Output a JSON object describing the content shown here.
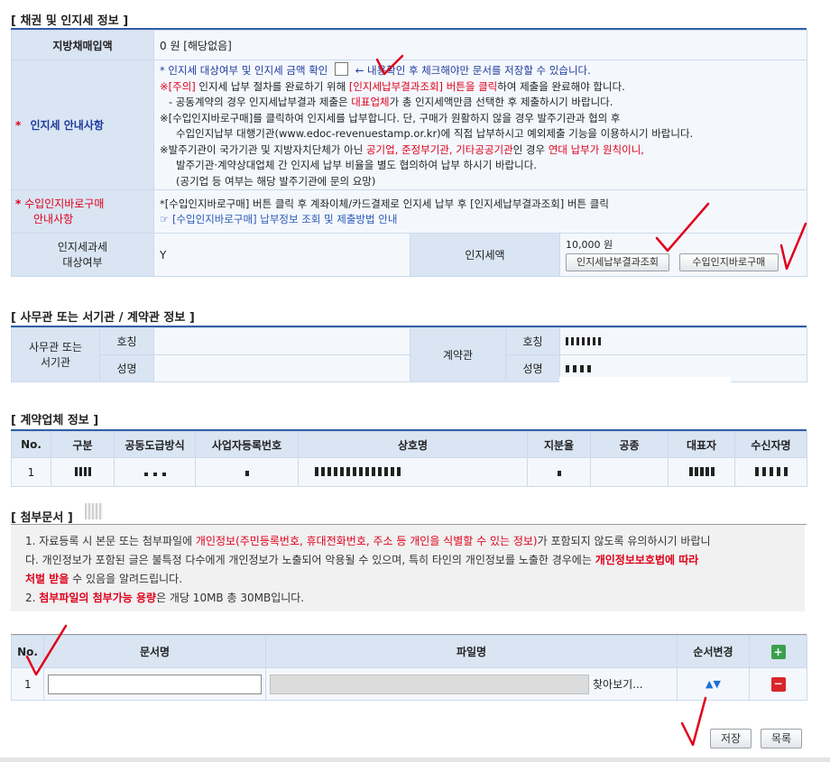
{
  "sec1": {
    "title": "[ 채권 및 인지세 정보 ]",
    "bond_label": "지방채매입액",
    "bond_value": "0 원  [해당없음]",
    "stamp_guide_label": "인지세 안내사항",
    "guide_line1_a": "* 인지세 대상여부 및 인지세 금액 확인",
    "guide_line1_b": "← 내용확인 후 체크해야만 문서를 저장할 수 있습니다.",
    "guide_line2_a": "※[주의]",
    "guide_line2_b": " 인지세 납부 절차를 완료하기 위해 ",
    "guide_line2_c": "[인지세납부결과조회] 버튼을 클릭",
    "guide_line2_d": "하여 제출을 완료해야 합니다.",
    "guide_line3_a": "- 공동계약의 경우 인지세납부결과 제출은 ",
    "guide_line3_b": "대표업체",
    "guide_line3_c": "가 총 인지세액만큼 선택한 후 제출하시기 바랍니다.",
    "guide_line4": "※[수입인지바로구매]를 클릭하여 인지세를 납부합니다. 단, 구매가 원활하지 않을 경우 발주기관과 협의 후",
    "guide_line5": "수입인지납부 대행기관(www.edoc-revenuestamp.or.kr)에 직접 납부하시고 예외제출 기능을 이용하시기 바랍니다.",
    "guide_line6_a": "※발주기관이 국가기관 및 지방자치단체가 아닌 ",
    "guide_line6_b": "공기업, 준정부기관, 기타공공기관",
    "guide_line6_c": "인 경우 ",
    "guide_line6_d": "연대 납부가 원칙이니,",
    "guide_line7": "발주기관·계약상대업체 간 인지세 납부 비율을 별도 협의하여 납부 하시기 바랍니다.",
    "guide_line8": "(공기업 등 여부는 해당 발주기관에 문의 요망)",
    "buy_guide_label_1": "수입인지바로구매",
    "buy_guide_label_2": "안내사항",
    "buy_line1": "*[수입인지바로구매] 버튼 클릭 후 계좌이체/카드결제로 인지세 납부 후 [인지세납부결과조회] 버튼 클릭",
    "buy_line2": "☞ [수입인지바로구매] 납부정보 조회 및 제출방법 안내",
    "target_label_1": "인지세과세",
    "target_label_2": "대상여부",
    "target_value": "Y",
    "amount_label": "인지세액",
    "amount_value": "10,000 원",
    "btn_result": "인지세납부결과조회",
    "btn_buy": "수입인지바로구매"
  },
  "sec2": {
    "title": "[ 사무관 또는 서기관 / 계약관 정보 ]",
    "officer_label_1": "사무관 또는",
    "officer_label_2": "서기관",
    "title_label": "호칭",
    "name_label": "성명",
    "contract_label": "계약관",
    "title_label2": "호칭",
    "name_label2": "성명"
  },
  "sec3": {
    "title": "[ 계약업체 정보 ]",
    "headers": [
      "No.",
      "구분",
      "공동도급방식",
      "사업자등록번호",
      "상호명",
      "지분율",
      "공종",
      "대표자",
      "수신자명"
    ],
    "row_no": "1"
  },
  "sec4": {
    "title": "[ 첨부문서 ]",
    "notice1_a": "1. 자료등록 시 본문 또는 첨부파일에 ",
    "notice1_b": "개인정보(주민등록번호, 휴대전화번호, 주소 등 개인을 식별할 수 있는 정보)",
    "notice1_c": "가 포함되지 않도록 유의하시기 바랍니",
    "notice1_d": "다. 개인정보가 포함된 글은 불특정 다수에게 개인정보가 노출되어 악용될 수 있으며, 특히 타인의 개인정보를 노출한 경우에는 ",
    "notice1_e": "개인정보보호법에 따라",
    "notice1_f": "처벌 받을",
    "notice1_g": " 수 있음을 알려드립니다.",
    "notice2_a": "2. ",
    "notice2_b": "첨부파일의 첨부가능 용량",
    "notice2_c": "은 개당 10MB 총 30MB입니다.",
    "headers": [
      "No.",
      "문서명",
      "파일명",
      "순서변경"
    ],
    "row_no": "1",
    "browse": "찾아보기...",
    "order_icons": "▲▼"
  },
  "footer": {
    "save": "저장",
    "list": "목록"
  }
}
